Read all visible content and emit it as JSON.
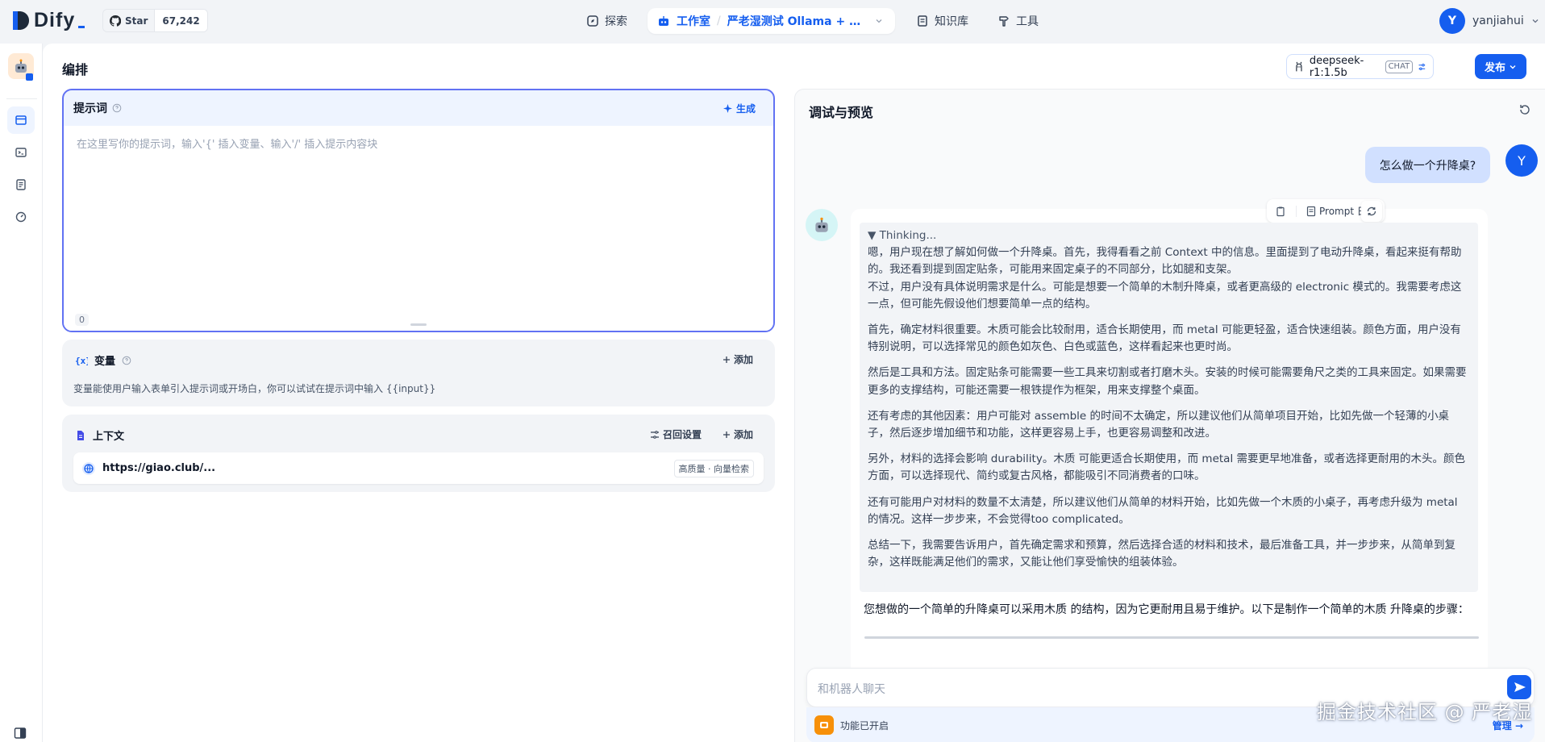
{
  "nav": {
    "logo": "Dify",
    "github_star_label": "Star",
    "github_star_count": "67,242",
    "explore": "探索",
    "studio": "工作室",
    "app_name": "严老湿测试 Ollama + Dee...",
    "knowledge": "知识库",
    "tools": "工具",
    "user_initial": "Y",
    "user_name": "yanjiahui"
  },
  "header": {
    "title": "编排",
    "model_name": "deepseek-r1:1.5b",
    "model_mode": "CHAT",
    "publish": "发布"
  },
  "prompt": {
    "title": "提示词",
    "generate": "生成",
    "placeholder": "在这里写你的提示词，输入'{' 插入变量、输入'/' 插入提示内容块",
    "char_count": "0"
  },
  "variables": {
    "title": "变量",
    "add": "添加",
    "hint": "变量能使用户输入表单引入提示词或开场白，你可以试试在提示词中输入 {{input}}"
  },
  "context": {
    "title": "上下文",
    "retrieval_settings": "召回设置",
    "add": "添加",
    "dataset_name": "https://giao.club/...",
    "dataset_tag": "高质量 · 向量检索"
  },
  "debug": {
    "title": "调试与预览",
    "user_initial": "Y",
    "user_message": "怎么做一个升降桌?",
    "prompt_log": "Prompt 日志",
    "thinking_label": "▼ Thinking...",
    "thinking_paragraphs": [
      "嗯，用户现在想了解如何做一个升降桌。首先，我得看看之前 Context 中的信息。里面提到了电动升降桌，看起来挺有帮助的。我还看到提到固定贴条，可能用来固定桌子的不同部分，比如腿和支架。\n不过，用户没有具体说明需求是什么。可能是想要一个简单的木制升降桌，或者更高级的 electronic 模式的。我需要考虑这一点，但可能先假设他们想要简单一点的结构。",
      "首先，确定材料很重要。木质可能会比较耐用，适合长期使用，而 metal 可能更轻盈，适合快速组装。颜色方面，用户没有特别说明，可以选择常见的颜色如灰色、白色或蓝色，这样看起来也更时尚。",
      "然后是工具和方法。固定贴条可能需要一些工具来切割或者打磨木头。安装的时候可能需要角尺之类的工具来固定。如果需要更多的支撑结构，可能还需要一根铁提作为框架，用来支撑整个桌面。",
      "还有考虑的其他因素：用户可能对 assemble 的时间不太确定，所以建议他们从简单项目开始，比如先做一个轻薄的小桌子，然后逐步增加细节和功能，这样更容易上手，也更容易调整和改进。",
      "另外，材料的选择会影响 durability。木质 可能更适合长期使用，而 metal 需要更早地准备，或者选择更耐用的木头。颜色方面，可以选择现代、简约或复古风格，都能吸引不同消费者的口味。",
      "还有可能用户对材料的数量不太清楚，所以建议他们从简单的材料开始，比如先做一个木质的小桌子，再考虑升级为 metal 的情况。这样一步步来，不会觉得too complicated。",
      "总结一下，我需要告诉用户，首先确定需求和预算，然后选择合适的材料和技术，最后准备工具，并一步步来，从简单到复杂，这样既能满足他们的需求，又能让他们享受愉快的组装体验。"
    ],
    "final_answer": "您想做的一个简单的升降桌可以采用木质 的结构，因为它更耐用且易于维护。以下是制作一个简单的木质 升降桌的步骤：",
    "input_placeholder": "和机器人聊天",
    "feature_status": "功能已开启",
    "manage": "管理 →"
  },
  "watermark": "掘金技术社区 @ 严老湿",
  "colors": {
    "primary": "#155eef",
    "prompt_border": "#6172f3",
    "user_bubble": "#d1e0ff",
    "background": "#f2f4f7"
  }
}
